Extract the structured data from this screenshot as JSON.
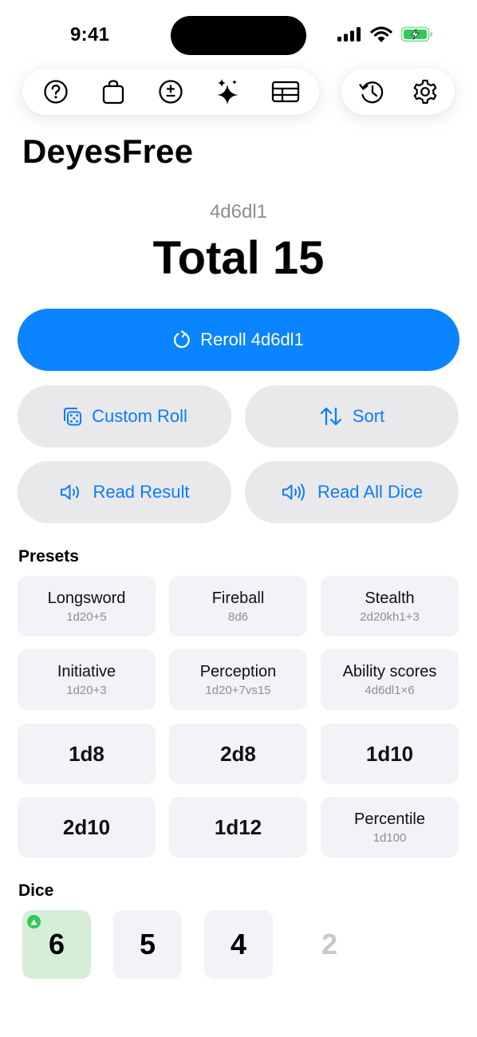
{
  "status_bar": {
    "time": "9:41"
  },
  "toolbar": {
    "main_icons": [
      "help-icon",
      "bag-icon",
      "plus-minus-icon",
      "sparkles-icon",
      "table-icon"
    ],
    "side_icons": [
      "history-icon",
      "settings-icon"
    ]
  },
  "app": {
    "title": "DeyesFree"
  },
  "result": {
    "expression": "4d6dl1",
    "total": "Total 15"
  },
  "actions": {
    "reroll": "Reroll 4d6dl1",
    "custom_roll": "Custom Roll",
    "sort": "Sort",
    "read_result": "Read Result",
    "read_all_dice": "Read All Dice"
  },
  "presets": {
    "title": "Presets",
    "items": [
      {
        "name": "Longsword",
        "expr": "1d20+5"
      },
      {
        "name": "Fireball",
        "expr": "8d6"
      },
      {
        "name": "Stealth",
        "expr": "2d20kh1+3"
      },
      {
        "name": "Initiative",
        "expr": "1d20+3"
      },
      {
        "name": "Perception",
        "expr": "1d20+7vs15"
      },
      {
        "name": "Ability scores",
        "expr": "4d6dl1×6"
      },
      {
        "name": "1d8"
      },
      {
        "name": "2d8"
      },
      {
        "name": "1d10"
      },
      {
        "name": "2d10"
      },
      {
        "name": "1d12"
      },
      {
        "name": "Percentile",
        "expr": "1d100"
      }
    ]
  },
  "dice": {
    "title": "Dice",
    "items": [
      {
        "value": "6",
        "state": "max"
      },
      {
        "value": "5",
        "state": "kept"
      },
      {
        "value": "4",
        "state": "kept"
      },
      {
        "value": "2",
        "state": "dropped"
      }
    ]
  },
  "colors": {
    "accent": "#0a84ff",
    "secondary_button_bg": "#e9e9eb",
    "tile_bg": "#f2f2f7",
    "max_die_bg": "#d6eed8",
    "badge_green": "#34c759",
    "dropped_text": "#c7c7cc"
  }
}
